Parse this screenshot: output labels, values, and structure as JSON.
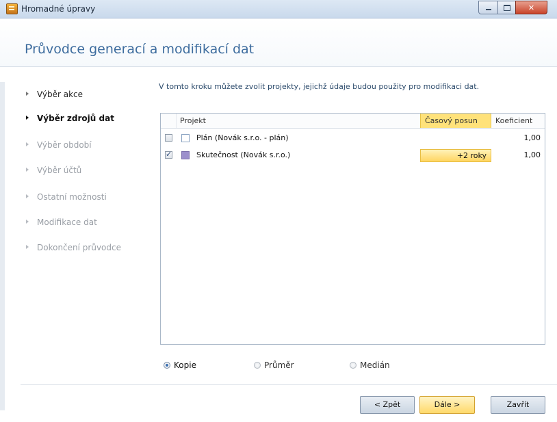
{
  "window": {
    "title": "Hromadné úpravy"
  },
  "header": {
    "title": "Průvodce generací a modifikací dat"
  },
  "steps": [
    {
      "label": "Výběr akce",
      "state": "done"
    },
    {
      "label": "Výběr zdrojů dat",
      "state": "current"
    },
    {
      "label": "Výběr období",
      "state": "todo"
    },
    {
      "label": "Výběr účtů",
      "state": "todo"
    },
    {
      "label": "Ostatní možnosti",
      "state": "todo"
    },
    {
      "label": "Modifikace dat",
      "state": "todo"
    },
    {
      "label": "Dokončení průvodce",
      "state": "todo"
    }
  ],
  "main": {
    "instruction": "V tomto kroku můžete zvolit projekty, jejichž údaje budou použity pro modifikaci dat.",
    "grid": {
      "columns": {
        "project": "Projekt",
        "time_shift": "Časový posun",
        "coefficient": "Koeficient"
      },
      "rows": [
        {
          "checked": false,
          "color": "#ffffff",
          "name": "Plán (Novák s.r.o. - plán)",
          "time_shift": "",
          "coefficient": "1,00"
        },
        {
          "checked": true,
          "color": "#9c8fcc",
          "name": "Skutečnost (Novák s.r.o.)",
          "time_shift": "+2 roky",
          "coefficient": "1,00"
        }
      ]
    },
    "mode": {
      "options": [
        "Kopie",
        "Průměr",
        "Medián"
      ],
      "selected": "Kopie"
    }
  },
  "footer": {
    "back_label": "< Zpět",
    "next_label": "Dále >",
    "close_label": "Zavřít"
  },
  "icons": [
    "app-icon",
    "minimize-icon",
    "maximize-icon",
    "close-icon",
    "step-arrow-icon",
    "checkbox-icon",
    "color-swatch-icon",
    "radio-icon"
  ]
}
